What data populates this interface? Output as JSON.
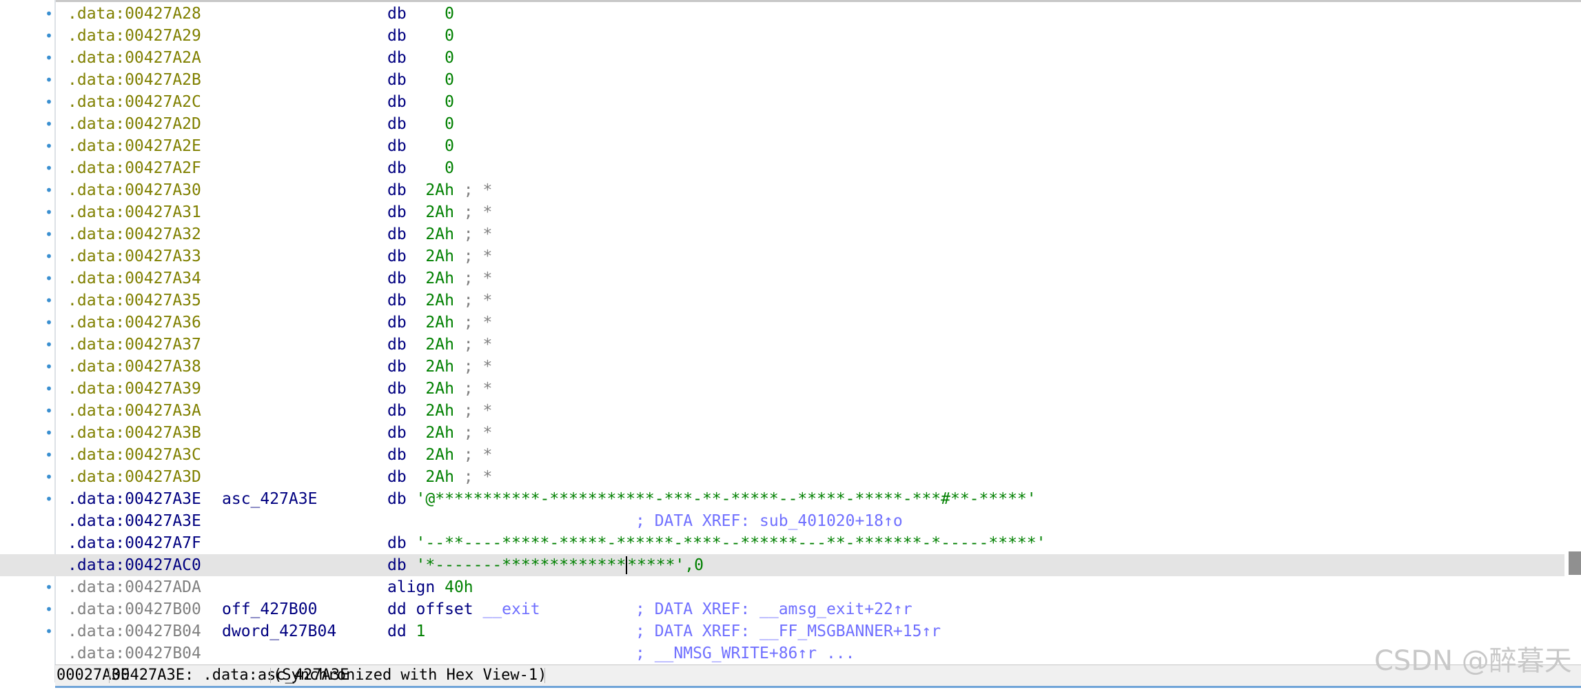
{
  "listing": {
    "rows": [
      {
        "bullet": "•",
        "addr": ".data:00427A28",
        "addr_class": "a-yel",
        "ins": [
          {
            "t": "db    ",
            "c": "dk"
          },
          {
            "t": "0",
            "c": "green"
          }
        ]
      },
      {
        "bullet": "•",
        "addr": ".data:00427A29",
        "addr_class": "a-yel",
        "ins": [
          {
            "t": "db    ",
            "c": "dk"
          },
          {
            "t": "0",
            "c": "green"
          }
        ]
      },
      {
        "bullet": "•",
        "addr": ".data:00427A2A",
        "addr_class": "a-yel",
        "ins": [
          {
            "t": "db    ",
            "c": "dk"
          },
          {
            "t": "0",
            "c": "green"
          }
        ]
      },
      {
        "bullet": "•",
        "addr": ".data:00427A2B",
        "addr_class": "a-yel",
        "ins": [
          {
            "t": "db    ",
            "c": "dk"
          },
          {
            "t": "0",
            "c": "green"
          }
        ]
      },
      {
        "bullet": "•",
        "addr": ".data:00427A2C",
        "addr_class": "a-yel",
        "ins": [
          {
            "t": "db    ",
            "c": "dk"
          },
          {
            "t": "0",
            "c": "green"
          }
        ]
      },
      {
        "bullet": "•",
        "addr": ".data:00427A2D",
        "addr_class": "a-yel",
        "ins": [
          {
            "t": "db    ",
            "c": "dk"
          },
          {
            "t": "0",
            "c": "green"
          }
        ]
      },
      {
        "bullet": "•",
        "addr": ".data:00427A2E",
        "addr_class": "a-yel",
        "ins": [
          {
            "t": "db    ",
            "c": "dk"
          },
          {
            "t": "0",
            "c": "green"
          }
        ]
      },
      {
        "bullet": "•",
        "addr": ".data:00427A2F",
        "addr_class": "a-yel",
        "ins": [
          {
            "t": "db    ",
            "c": "dk"
          },
          {
            "t": "0",
            "c": "green"
          }
        ]
      },
      {
        "bullet": "•",
        "addr": ".data:00427A30",
        "addr_class": "a-yel",
        "ins": [
          {
            "t": "db  ",
            "c": "dk"
          },
          {
            "t": "2Ah",
            "c": "green"
          },
          {
            "t": " ; *",
            "c": "scmt"
          }
        ]
      },
      {
        "bullet": "•",
        "addr": ".data:00427A31",
        "addr_class": "a-yel",
        "ins": [
          {
            "t": "db  ",
            "c": "dk"
          },
          {
            "t": "2Ah",
            "c": "green"
          },
          {
            "t": " ; *",
            "c": "scmt"
          }
        ]
      },
      {
        "bullet": "•",
        "addr": ".data:00427A32",
        "addr_class": "a-yel",
        "ins": [
          {
            "t": "db  ",
            "c": "dk"
          },
          {
            "t": "2Ah",
            "c": "green"
          },
          {
            "t": " ; *",
            "c": "scmt"
          }
        ]
      },
      {
        "bullet": "•",
        "addr": ".data:00427A33",
        "addr_class": "a-yel",
        "ins": [
          {
            "t": "db  ",
            "c": "dk"
          },
          {
            "t": "2Ah",
            "c": "green"
          },
          {
            "t": " ; *",
            "c": "scmt"
          }
        ]
      },
      {
        "bullet": "•",
        "addr": ".data:00427A34",
        "addr_class": "a-yel",
        "ins": [
          {
            "t": "db  ",
            "c": "dk"
          },
          {
            "t": "2Ah",
            "c": "green"
          },
          {
            "t": " ; *",
            "c": "scmt"
          }
        ]
      },
      {
        "bullet": "•",
        "addr": ".data:00427A35",
        "addr_class": "a-yel",
        "ins": [
          {
            "t": "db  ",
            "c": "dk"
          },
          {
            "t": "2Ah",
            "c": "green"
          },
          {
            "t": " ; *",
            "c": "scmt"
          }
        ]
      },
      {
        "bullet": "•",
        "addr": ".data:00427A36",
        "addr_class": "a-yel",
        "ins": [
          {
            "t": "db  ",
            "c": "dk"
          },
          {
            "t": "2Ah",
            "c": "green"
          },
          {
            "t": " ; *",
            "c": "scmt"
          }
        ]
      },
      {
        "bullet": "•",
        "addr": ".data:00427A37",
        "addr_class": "a-yel",
        "ins": [
          {
            "t": "db  ",
            "c": "dk"
          },
          {
            "t": "2Ah",
            "c": "green"
          },
          {
            "t": " ; *",
            "c": "scmt"
          }
        ]
      },
      {
        "bullet": "•",
        "addr": ".data:00427A38",
        "addr_class": "a-yel",
        "ins": [
          {
            "t": "db  ",
            "c": "dk"
          },
          {
            "t": "2Ah",
            "c": "green"
          },
          {
            "t": " ; *",
            "c": "scmt"
          }
        ]
      },
      {
        "bullet": "•",
        "addr": ".data:00427A39",
        "addr_class": "a-yel",
        "ins": [
          {
            "t": "db  ",
            "c": "dk"
          },
          {
            "t": "2Ah",
            "c": "green"
          },
          {
            "t": " ; *",
            "c": "scmt"
          }
        ]
      },
      {
        "bullet": "•",
        "addr": ".data:00427A3A",
        "addr_class": "a-yel",
        "ins": [
          {
            "t": "db  ",
            "c": "dk"
          },
          {
            "t": "2Ah",
            "c": "green"
          },
          {
            "t": " ; *",
            "c": "scmt"
          }
        ]
      },
      {
        "bullet": "•",
        "addr": ".data:00427A3B",
        "addr_class": "a-yel",
        "ins": [
          {
            "t": "db  ",
            "c": "dk"
          },
          {
            "t": "2Ah",
            "c": "green"
          },
          {
            "t": " ; *",
            "c": "scmt"
          }
        ]
      },
      {
        "bullet": "•",
        "addr": ".data:00427A3C",
        "addr_class": "a-yel",
        "ins": [
          {
            "t": "db  ",
            "c": "dk"
          },
          {
            "t": "2Ah",
            "c": "green"
          },
          {
            "t": " ; *",
            "c": "scmt"
          }
        ]
      },
      {
        "bullet": "•",
        "addr": ".data:00427A3D",
        "addr_class": "a-yel",
        "ins": [
          {
            "t": "db  ",
            "c": "dk"
          },
          {
            "t": "2Ah",
            "c": "green"
          },
          {
            "t": " ; *",
            "c": "scmt"
          }
        ]
      },
      {
        "bullet": "•",
        "addr": ".data:00427A3E",
        "addr_class": "a-blue",
        "name": "asc_427A3E",
        "ins": [
          {
            "t": "db ",
            "c": "dk"
          },
          {
            "t": "'@***********-***********-***-**-*****--*****-*****-***#**-*****'",
            "c": "green"
          }
        ]
      },
      {
        "bullet": "",
        "addr": ".data:00427A3E",
        "addr_class": "a-blue",
        "comment": [
          {
            "t": "; DATA XREF: sub_401020+18↑o",
            "c": "lnk"
          }
        ]
      },
      {
        "bullet": "",
        "addr": ".data:00427A7F",
        "addr_class": "a-blue",
        "ins": [
          {
            "t": "db ",
            "c": "dk"
          },
          {
            "t": "'--**----*****-*****-******-****--******---**-*******-*-----*****'",
            "c": "green"
          }
        ]
      },
      {
        "bullet": "",
        "addr": ".data:00427AC0",
        "addr_class": "a-blue",
        "current": true,
        "ins": [
          {
            "t": "db ",
            "c": "dk"
          },
          {
            "t": "'*-------*************",
            "c": "green"
          },
          {
            "t": "*****'",
            "c": "green",
            "caret": true
          },
          {
            "t": ",0",
            "c": "green"
          }
        ]
      },
      {
        "bullet": "•",
        "addr": ".data:00427ADA",
        "addr_class": "a-gray",
        "ins": [
          {
            "t": "align ",
            "c": "dk"
          },
          {
            "t": "40h",
            "c": "green"
          }
        ]
      },
      {
        "bullet": "•",
        "addr": ".data:00427B00",
        "addr_class": "a-gray",
        "name": "off_427B00",
        "ins": [
          {
            "t": "dd offset ",
            "c": "dk"
          },
          {
            "t": "__exit",
            "c": "lnk"
          }
        ],
        "comment": [
          {
            "t": "; DATA XREF: __amsg_exit+22↑r",
            "c": "lnk"
          }
        ]
      },
      {
        "bullet": "•",
        "addr": ".data:00427B04",
        "addr_class": "a-gray",
        "name": "dword_427B04",
        "ins": [
          {
            "t": "dd ",
            "c": "dk"
          },
          {
            "t": "1",
            "c": "green"
          }
        ],
        "comment": [
          {
            "t": "; DATA XREF: __FF_MSGBANNER+15↑r",
            "c": "lnk"
          }
        ]
      },
      {
        "bullet": "",
        "addr": ".data:00427B04",
        "addr_class": "a-gray",
        "comment": [
          {
            "t": "; __NMSG_WRITE+86↑r ...",
            "c": "lnk"
          }
        ]
      }
    ]
  },
  "statusbar": {
    "file_offset": "00027A3E",
    "location": "00427A3E: .data:asc_427A3E",
    "sync": "(Synchronized with Hex View-1)"
  },
  "watermark": "CSDN @醉暮天",
  "colors": {
    "address_yellow": "#808000",
    "address_blue": "#000080",
    "string_green": "#008000",
    "comment_link": "#7070ff",
    "current_line": "#e4e4e4"
  }
}
